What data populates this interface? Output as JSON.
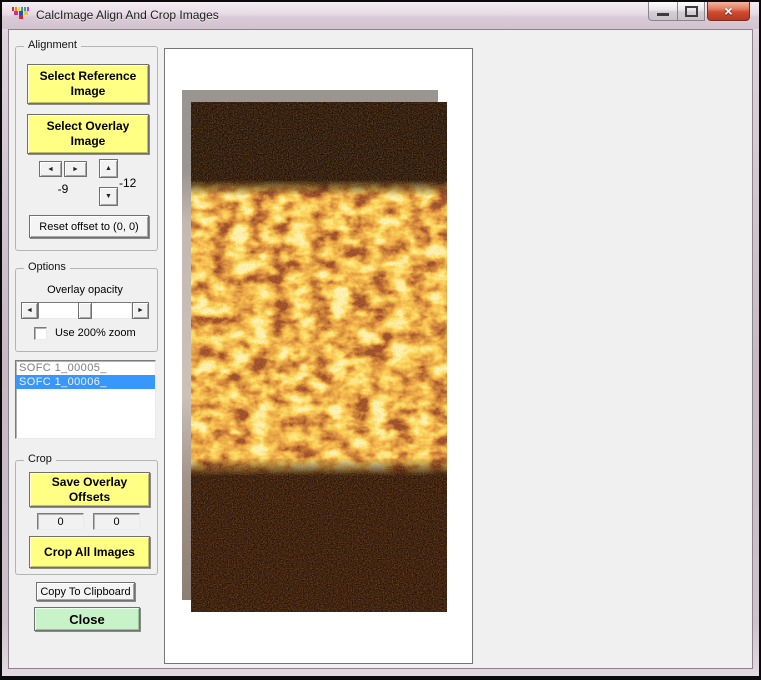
{
  "window": {
    "title": "CalcImage Align And Crop Images"
  },
  "icons": {
    "app_icon": "color-grid",
    "minimize": "horizontal-bar",
    "maximize": "square-outline",
    "close": "×",
    "arrow_left": "◄",
    "arrow_right": "►",
    "arrow_up": "▲",
    "arrow_down": "▼"
  },
  "alignment": {
    "legend": "Alignment",
    "select_reference_label": "Select Reference Image",
    "select_overlay_label": "Select Overlay Image",
    "x_offset": "-9",
    "y_offset": "-12",
    "reset_label": "Reset offset to (0, 0)"
  },
  "options": {
    "legend": "Options",
    "opacity_label": "Overlay opacity",
    "zoom_checkbox_label": "Use 200% zoom",
    "zoom_checkbox_checked": false
  },
  "files": {
    "items": [
      "SOFC 1_00005_",
      "SOFC 1_00006_"
    ],
    "selected_index": 1
  },
  "crop": {
    "legend": "Crop",
    "save_offsets_label": "Save Overlay Offsets",
    "offset_x_value": "0",
    "offset_y_value": "0",
    "crop_all_label": "Crop All Images"
  },
  "footer": {
    "copy_label": "Copy To Clipboard",
    "close_label": "Close"
  },
  "colors": {
    "action_button_bg": "#FFFF84",
    "close_button_bg": "#C8F2C8",
    "list_selection_bg": "#3797FD",
    "titlebar_bg": "#E6DBE4",
    "client_bg": "#F0F0F0",
    "reference_image_gray": "#9B9591",
    "overlay_dark": "#1C0E07",
    "overlay_bright": "#F0962B"
  }
}
